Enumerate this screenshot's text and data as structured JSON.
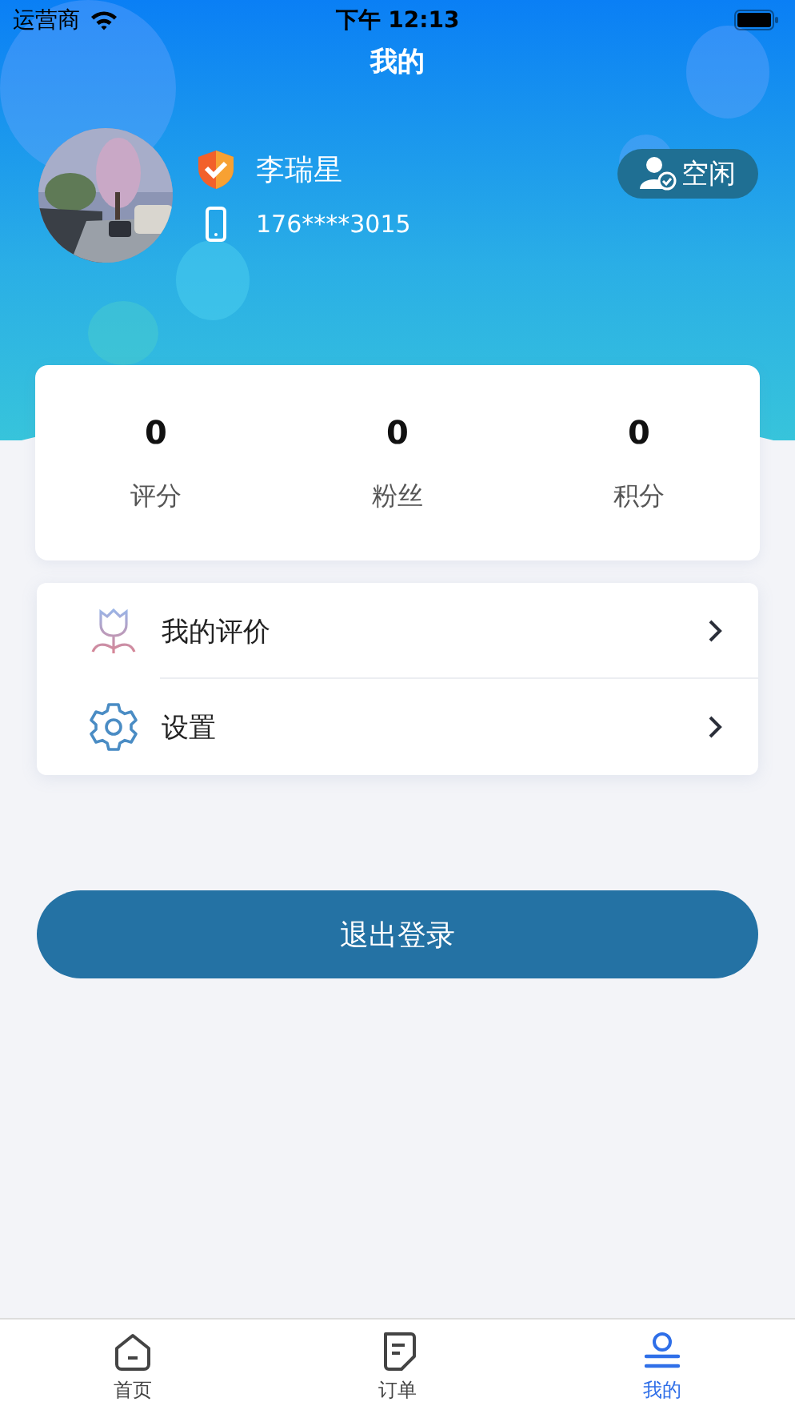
{
  "status_bar": {
    "carrier": "运营商",
    "time": "下午 12:13"
  },
  "title": "我的",
  "profile": {
    "name": "李瑞星",
    "phone": "176****3015",
    "status": "空闲"
  },
  "stats": [
    {
      "value": "0",
      "label": "评分"
    },
    {
      "value": "0",
      "label": "粉丝"
    },
    {
      "value": "0",
      "label": "积分"
    }
  ],
  "menu": [
    {
      "kind": "reviews",
      "label": "我的评价"
    },
    {
      "kind": "settings",
      "label": "设置"
    }
  ],
  "logout_button": "退出登录",
  "tab_bar": [
    {
      "kind": "home",
      "label": "首页",
      "selected": false
    },
    {
      "kind": "orders",
      "label": "订单",
      "selected": false
    },
    {
      "kind": "profile",
      "label": "我的",
      "selected": true
    }
  ]
}
